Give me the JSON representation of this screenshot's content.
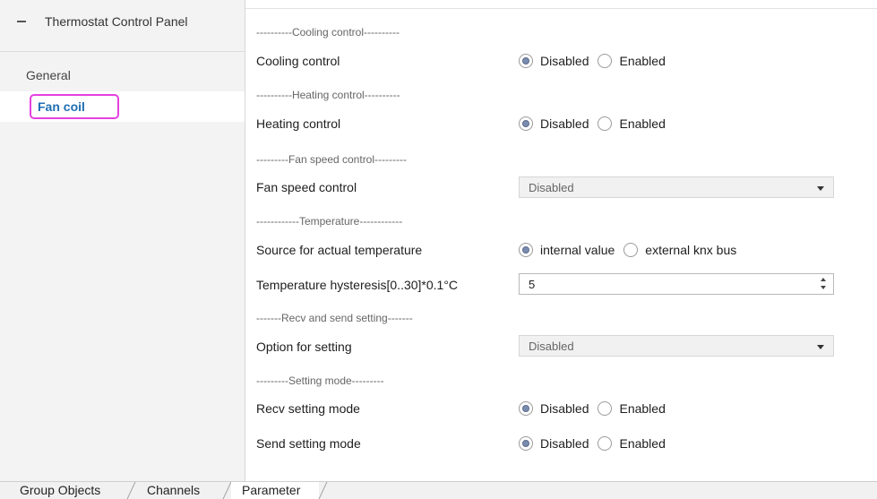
{
  "sidebar": {
    "tree_title": "Thermostat Control Panel",
    "collapse_symbol": "−",
    "items": [
      {
        "label": "General"
      },
      {
        "label": "Fan coil"
      }
    ]
  },
  "sections": {
    "cooling_header": "----------Cooling control----------",
    "heating_header": "----------Heating control----------",
    "fan_header": "---------Fan speed control---------",
    "temp_header": "------------Temperature------------",
    "recv_header": "-------Recv and send setting-------",
    "mode_header": "---------Setting mode---------"
  },
  "fields": {
    "cooling_control": {
      "label": "Cooling control",
      "options": [
        "Disabled",
        "Enabled"
      ],
      "selected": "Disabled"
    },
    "heating_control": {
      "label": "Heating control",
      "options": [
        "Disabled",
        "Enabled"
      ],
      "selected": "Disabled"
    },
    "fan_speed_control": {
      "label": "Fan speed control",
      "value": "Disabled"
    },
    "source_temperature": {
      "label": "Source for actual temperature",
      "options": [
        "internal value",
        "external knx bus"
      ],
      "selected": "internal value"
    },
    "temp_hysteresis": {
      "label": "Temperature hysteresis[0..30]*0.1°C",
      "value": "5"
    },
    "option_for_setting": {
      "label": "Option for setting",
      "value": "Disabled"
    },
    "recv_setting_mode": {
      "label": "Recv setting mode",
      "options": [
        "Disabled",
        "Enabled"
      ],
      "selected": "Disabled"
    },
    "send_setting_mode": {
      "label": "Send setting mode",
      "options": [
        "Disabled",
        "Enabled"
      ],
      "selected": "Disabled"
    }
  },
  "bottom_tabs": [
    {
      "label": "Group Objects"
    },
    {
      "label": "Channels"
    },
    {
      "label": "Parameter",
      "active": true
    }
  ],
  "colors": {
    "highlight_border": "#e640e0",
    "active_nav_text": "#1f6fb5"
  }
}
